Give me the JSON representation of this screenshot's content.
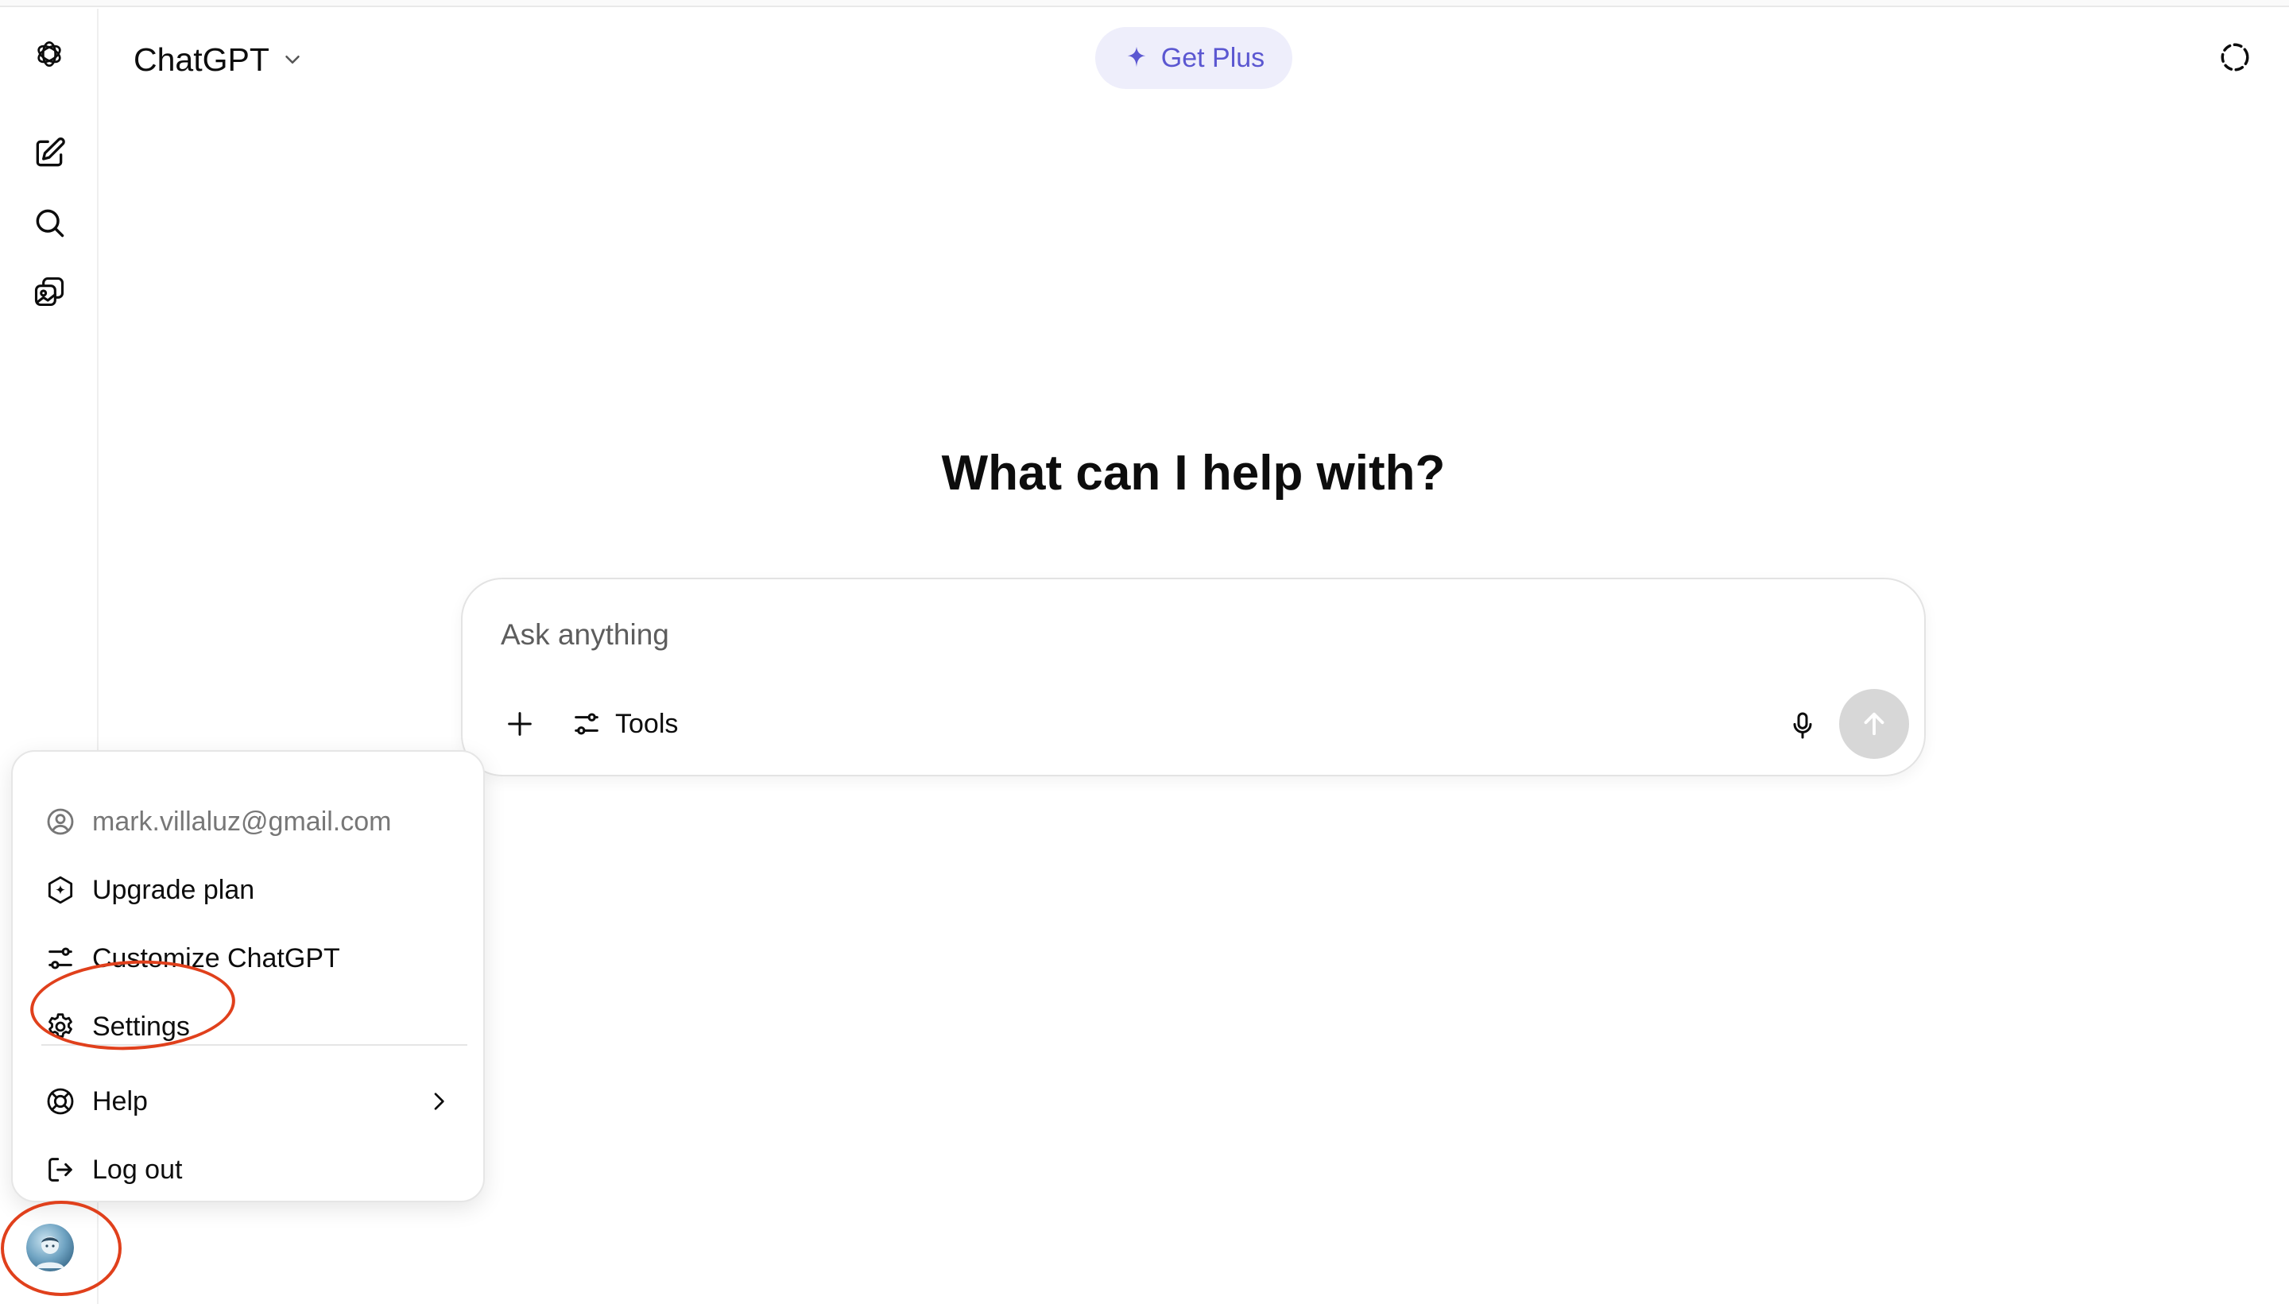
{
  "header": {
    "model_selector_label": "ChatGPT",
    "get_plus_label": "Get Plus"
  },
  "hero": {
    "title": "What can I help with?"
  },
  "composer": {
    "placeholder": "Ask anything",
    "tools_label": "Tools"
  },
  "profile_menu": {
    "email": "mark.villaluz@gmail.com",
    "items": [
      {
        "label": "Upgrade plan",
        "icon": "upgrade-icon"
      },
      {
        "label": "Customize ChatGPT",
        "icon": "sliders-icon"
      },
      {
        "label": "Settings",
        "icon": "gear-icon"
      },
      {
        "label": "Help",
        "icon": "lifebuoy-icon"
      },
      {
        "label": "Log out",
        "icon": "logout-icon"
      }
    ]
  },
  "colors": {
    "accent": "#5b57d1",
    "get_plus_bg": "#eeeefb",
    "annotation": "#e0401c",
    "send_disabled": "#d7d7d7"
  }
}
